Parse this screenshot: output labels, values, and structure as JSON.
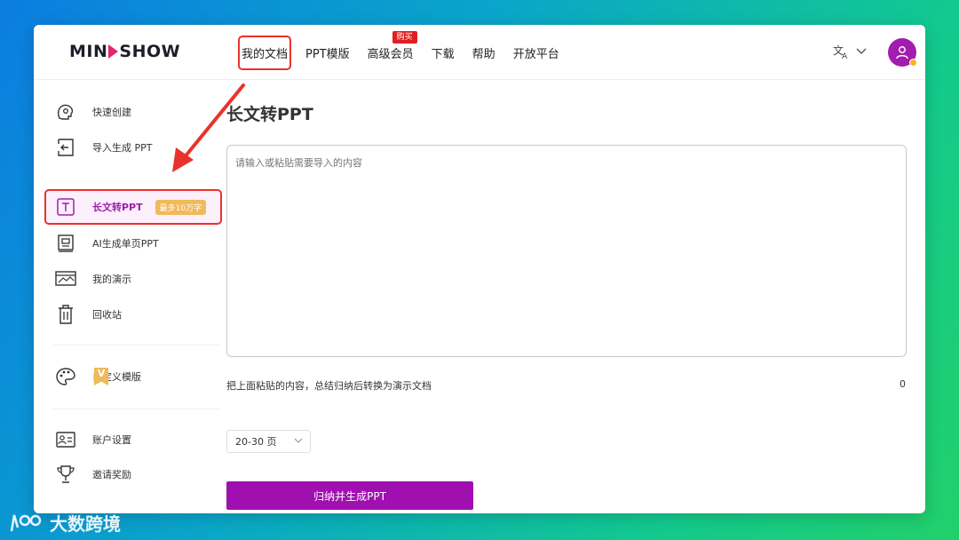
{
  "header": {
    "logo": "MINDSHOW",
    "nav": [
      "我的文档",
      "PPT模版",
      "高级会员",
      "下载",
      "帮助",
      "开放平台"
    ],
    "buy_badge": "购买"
  },
  "sidebar": {
    "items": [
      {
        "label": "快速创建",
        "icon": "lightbulb-head-icon"
      },
      {
        "label": "导入生成 PPT",
        "icon": "import-icon"
      },
      {
        "label": "长文转PPT",
        "icon": "text-t-icon",
        "badge": "最多10万字"
      },
      {
        "label": "AI生成单页PPT",
        "icon": "slide-icon"
      },
      {
        "label": "我的演示",
        "icon": "presentation-icon"
      },
      {
        "label": "回收站",
        "icon": "trash-icon"
      }
    ],
    "custom_template": "自定义模版",
    "v_badge": "V",
    "account_settings": "账户设置",
    "invite_rewards": "邀请奖励"
  },
  "main": {
    "title": "长文转PPT",
    "textarea_placeholder": "请输入或粘贴需要导入的内容",
    "hint": "把上面粘贴的内容，总结归纳后转换为演示文档",
    "char_count": "0",
    "page_select": "20-30 页",
    "generate_button": "归纳并生成PPT"
  },
  "watermark": "大数跨境",
  "colors": {
    "brand": "#a00fb0",
    "highlight": "#e8332a",
    "badge": "#f0b95a"
  }
}
